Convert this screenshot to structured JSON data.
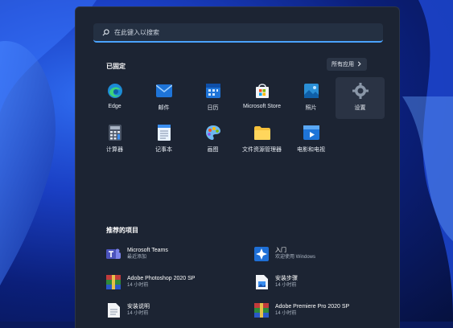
{
  "search": {
    "placeholder": "在此键入以搜索",
    "icon": "search-icon"
  },
  "pinned": {
    "title": "已固定",
    "all_apps_label": "所有应用",
    "apps": [
      {
        "label": "Edge",
        "icon": "edge-icon"
      },
      {
        "label": "邮件",
        "icon": "mail-icon"
      },
      {
        "label": "日历",
        "icon": "calendar-icon"
      },
      {
        "label": "Microsoft Store",
        "icon": "store-icon"
      },
      {
        "label": "照片",
        "icon": "photos-icon"
      },
      {
        "label": "设置",
        "icon": "gear-icon",
        "highlighted": true
      },
      {
        "label": "计算器",
        "icon": "calculator-icon"
      },
      {
        "label": "记事本",
        "icon": "notepad-icon"
      },
      {
        "label": "画图",
        "icon": "paint-icon"
      },
      {
        "label": "文件资源管理器",
        "icon": "folder-icon"
      },
      {
        "label": "电影和电视",
        "icon": "movies-icon"
      }
    ]
  },
  "recommended": {
    "title": "推荐的项目",
    "items": [
      {
        "name": "Microsoft Teams",
        "sub": "最近添加",
        "icon": "teams-icon"
      },
      {
        "name": "入门",
        "sub": "欢迎使用 Windows",
        "icon": "get-started-icon"
      },
      {
        "name": "Adobe Photoshop 2020 SP",
        "sub": "14 小时前",
        "icon": "archive-icon"
      },
      {
        "name": "安装步骤",
        "sub": "14 小时前",
        "icon": "image-file-icon"
      },
      {
        "name": "安装说明",
        "sub": "14 小时前",
        "icon": "text-file-icon"
      },
      {
        "name": "Adobe Premiere Pro 2020 SP",
        "sub": "14 小时前",
        "icon": "archive-icon"
      }
    ]
  },
  "colors": {
    "panel": "#1c2433",
    "accent": "#4aa3ff"
  }
}
